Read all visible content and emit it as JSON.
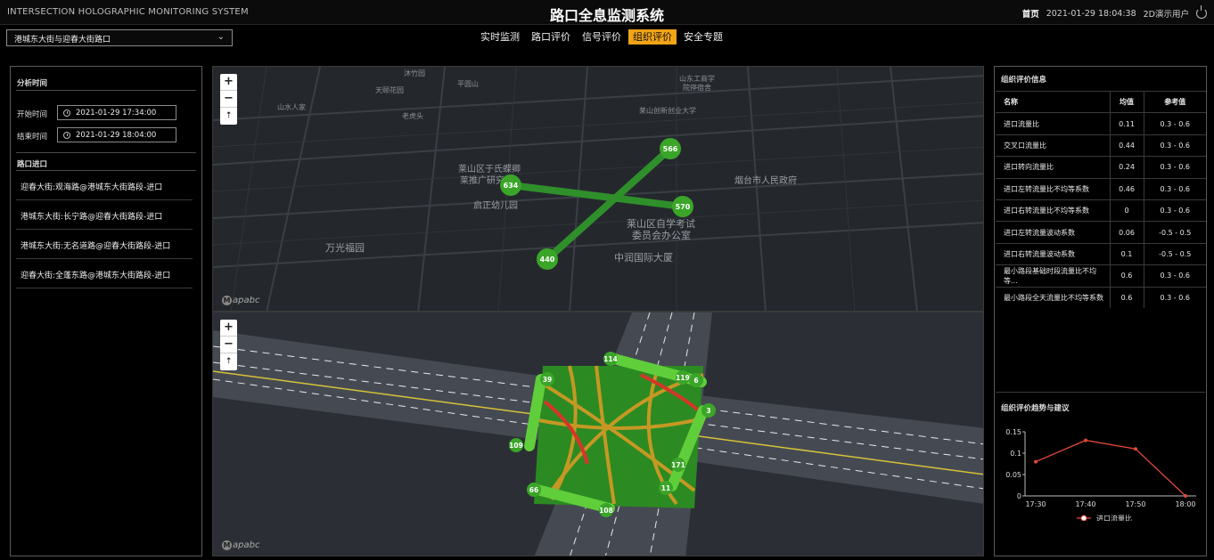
{
  "header": {
    "system_en": "INTERSECTION HOLOGRAPHIC MONITORING SYSTEM",
    "system_cn": "路口全息监测系统",
    "home": "首页",
    "datetime": "2021-01-29 18:04:38",
    "user": "2D演示用户"
  },
  "selector": {
    "value": "港城东大街与迎春大街路口"
  },
  "nav": {
    "tabs": [
      {
        "label": "实时监测",
        "active": false
      },
      {
        "label": "路口评价",
        "active": false
      },
      {
        "label": "信号评价",
        "active": false
      },
      {
        "label": "组织评价",
        "active": true
      },
      {
        "label": "安全专题",
        "active": false
      }
    ]
  },
  "left": {
    "analysis_title": "分析时间",
    "start_label": "开始时间",
    "start_value": "2021-01-29 17:34:00",
    "end_label": "结束时间",
    "end_value": "2021-01-29 18:04:00",
    "entries_title": "路口进口",
    "entries": [
      "迎春大街:观海路@港城东大街路段-进口",
      "港城东大街:长宁路@迎春大街路段-进口",
      "港城东大街:无名道路@迎春大街路段-进口",
      "迎春大街:全蓬东路@港城东大街路段-进口"
    ]
  },
  "map_top": {
    "labels": [
      "沐竹园",
      "平圆山",
      "山东工商学",
      "院停宿舍",
      "天颐花园",
      "山水人家",
      "老虎头",
      "莱山创新创业大学",
      "莱山区于氏蝶卿",
      "莱推广研究",
      "启正幼儿园",
      "烟台市人民政府",
      "莱山区自学考试",
      "委员会办公室",
      "万光福园",
      "中润国际大厦"
    ],
    "nodes": [
      "566",
      "634",
      "570",
      "440"
    ],
    "logo": "apabc"
  },
  "map_bottom": {
    "nodes": [
      "114",
      "39",
      "3",
      "109",
      "119",
      "6",
      "171",
      "11",
      "66",
      "108"
    ],
    "logo": "apabc"
  },
  "right": {
    "eval_title": "组织评价信息",
    "columns": [
      "名称",
      "均值",
      "参考值"
    ],
    "rows": [
      [
        "进口流量比",
        "0.11",
        "0.3 - 0.6"
      ],
      [
        "交叉口流量比",
        "0.44",
        "0.3 - 0.6"
      ],
      [
        "进口转向流量比",
        "0.24",
        "0.3 - 0.6"
      ],
      [
        "进口左转流量比不均等系数",
        "0.46",
        "0.3 - 0.6"
      ],
      [
        "进口右转流量比不均等系数",
        "0",
        "0.3 - 0.6"
      ],
      [
        "进口左转流量波动系数",
        "0.06",
        "-0.5 - 0.5"
      ],
      [
        "进口右转流量波动系数",
        "0.1",
        "-0.5 - 0.5"
      ],
      [
        "最小路段基础时段流量比不均等...",
        "0.6",
        "0.3 - 0.6"
      ],
      [
        "最小路段全天流量比不均等系数",
        "0.6",
        "0.3 - 0.6"
      ]
    ],
    "trend_title": "组织评价趋势与建议"
  },
  "chart_data": {
    "type": "line",
    "categories": [
      "17:30",
      "17:40",
      "17:50",
      "18:00"
    ],
    "series": [
      {
        "name": "进口流量比",
        "values": [
          0.08,
          0.13,
          0.11,
          0.0
        ]
      }
    ],
    "x": [
      17.42,
      17.67,
      17.92,
      18.0
    ],
    "ylim": [
      0,
      0.15
    ],
    "yticks": [
      "0",
      "0.05",
      "0.1",
      "0.15"
    ],
    "color": "#e0483a",
    "legend": "bottom"
  }
}
